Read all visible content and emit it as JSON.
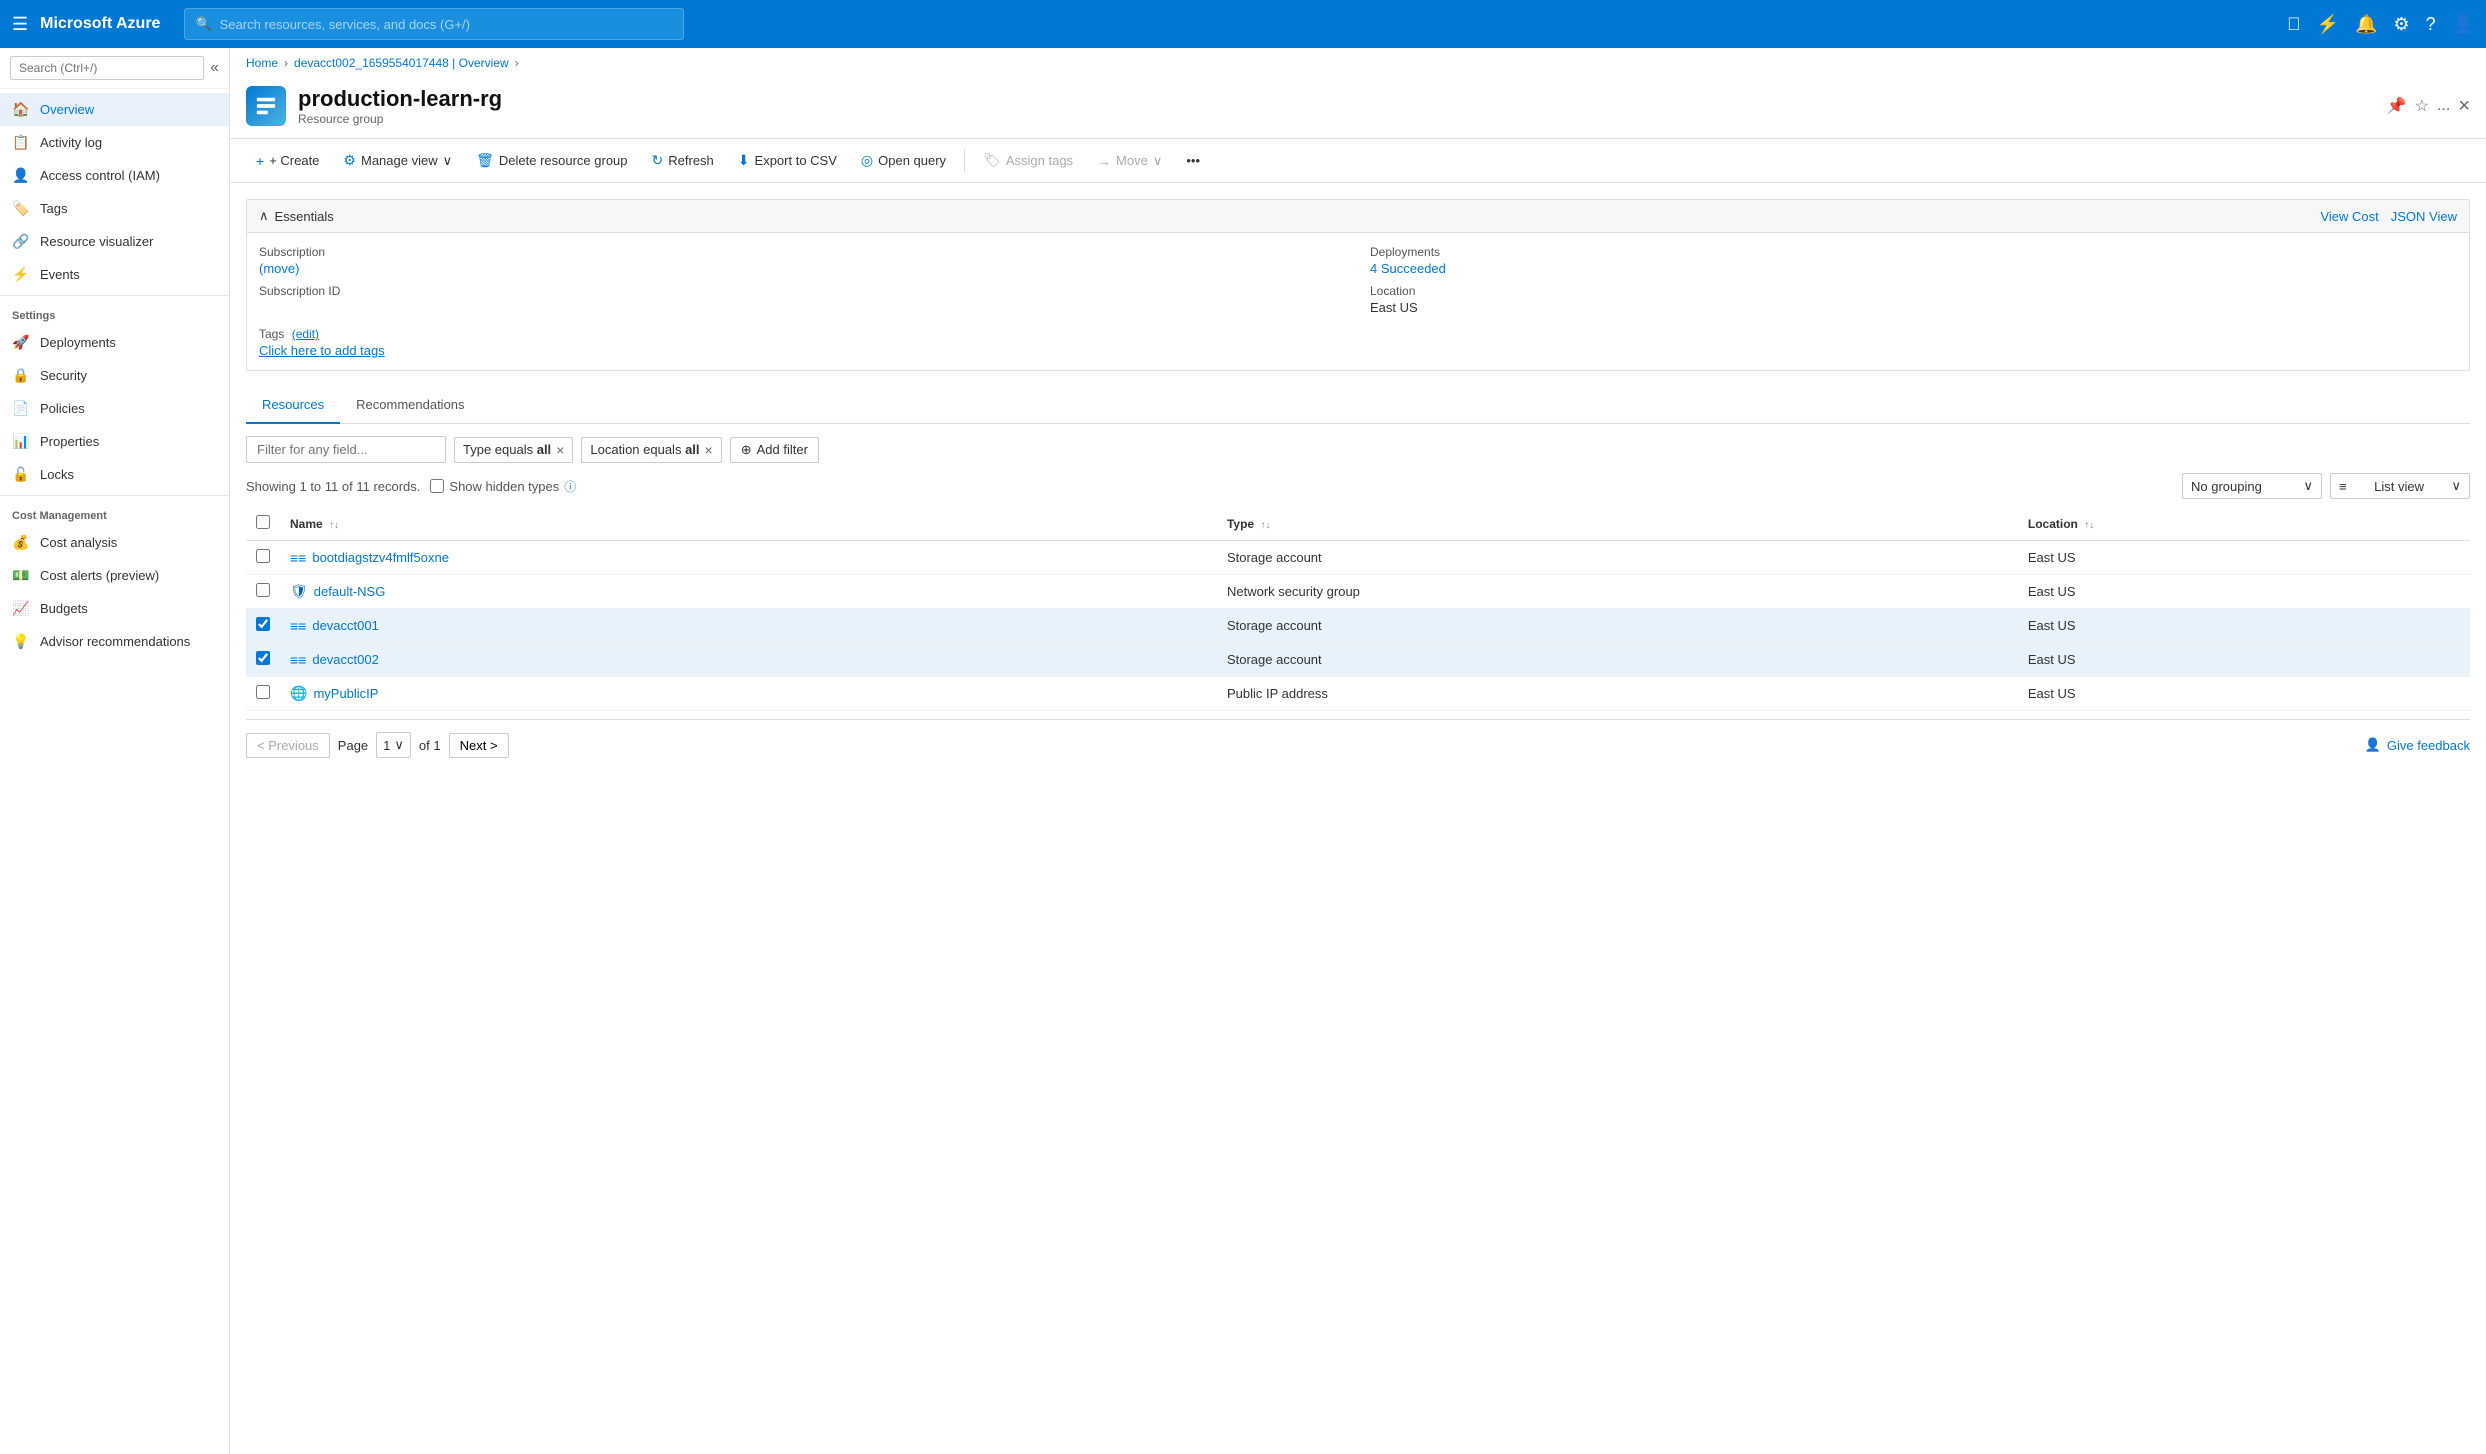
{
  "topbar": {
    "hamburger": "☰",
    "logo": "Microsoft Azure",
    "search_placeholder": "Search resources, services, and docs (G+/)",
    "icons": [
      "envelope",
      "portal",
      "bell",
      "settings",
      "help",
      "user"
    ]
  },
  "breadcrumb": {
    "items": [
      "Home",
      "devacct002_1659554017448 | Overview"
    ]
  },
  "page": {
    "title": "production-learn-rg",
    "subtitle": "Resource group",
    "close_label": "×"
  },
  "header_actions": {
    "pin": "📌",
    "star": "☆",
    "more": "..."
  },
  "toolbar": {
    "create": "+ Create",
    "manage_view": "Manage view",
    "delete": "Delete resource group",
    "refresh": "Refresh",
    "export": "Export to CSV",
    "open_query": "Open query",
    "assign_tags": "Assign tags",
    "move": "Move"
  },
  "essentials": {
    "section_title": "Essentials",
    "view_cost": "View Cost",
    "json_view": "JSON View",
    "fields": [
      {
        "label": "Subscription",
        "value": "",
        "link": "move",
        "link_text": "(move)"
      },
      {
        "label": "Subscription ID",
        "value": ""
      },
      {
        "label": "Deployments",
        "value": "4 Succeeded",
        "is_link": true
      },
      {
        "label": "Location",
        "value": "East US"
      }
    ],
    "tags_label": "Tags",
    "tags_edit": "(edit)",
    "tags_add_link": "Click here to add tags"
  },
  "tabs": {
    "items": [
      "Resources",
      "Recommendations"
    ],
    "active": 0
  },
  "filters": {
    "placeholder": "Filter for any field...",
    "chips": [
      {
        "label": "Type equals all"
      },
      {
        "label": "Location equals all"
      }
    ],
    "add_filter": "Add filter"
  },
  "table_controls": {
    "count_text": "Showing 1 to 11 of 11 records.",
    "show_hidden": "Show hidden types",
    "grouping": "No grouping",
    "view": "List view"
  },
  "table": {
    "columns": [
      "Name",
      "Type",
      "Location"
    ],
    "rows": [
      {
        "name": "bootdiagstzv4fmlf5oxne",
        "type": "Storage account",
        "location": "East US",
        "icon": "storage",
        "selected": false
      },
      {
        "name": "default-NSG",
        "type": "Network security group",
        "location": "East US",
        "icon": "nsg",
        "selected": false
      },
      {
        "name": "devacct001",
        "type": "Storage account",
        "location": "East US",
        "icon": "storage",
        "selected": true
      },
      {
        "name": "devacct002",
        "type": "Storage account",
        "location": "East US",
        "icon": "storage",
        "selected": true
      },
      {
        "name": "myPublicIP",
        "type": "Public IP address",
        "location": "East US",
        "icon": "ip",
        "selected": false
      }
    ]
  },
  "pagination": {
    "prev": "< Previous",
    "page_label": "Page",
    "page_num": "1",
    "of_label": "of 1",
    "next": "Next >",
    "feedback": "Give feedback"
  },
  "sidebar": {
    "search_placeholder": "Search (Ctrl+/)",
    "items": [
      {
        "label": "Overview",
        "icon": "🏠",
        "active": true,
        "section": ""
      },
      {
        "label": "Activity log",
        "icon": "📋",
        "active": false,
        "section": ""
      },
      {
        "label": "Access control (IAM)",
        "icon": "👤",
        "active": false,
        "section": ""
      },
      {
        "label": "Tags",
        "icon": "🏷️",
        "active": false,
        "section": ""
      },
      {
        "label": "Resource visualizer",
        "icon": "🔗",
        "active": false,
        "section": ""
      },
      {
        "label": "Events",
        "icon": "⚡",
        "active": false,
        "section": ""
      }
    ],
    "settings_label": "Settings",
    "settings_items": [
      {
        "label": "Deployments",
        "icon": "🚀"
      },
      {
        "label": "Security",
        "icon": "🔒"
      },
      {
        "label": "Policies",
        "icon": "📄"
      },
      {
        "label": "Properties",
        "icon": "📊"
      },
      {
        "label": "Locks",
        "icon": "🔓"
      }
    ],
    "cost_label": "Cost Management",
    "cost_items": [
      {
        "label": "Cost analysis",
        "icon": "💰"
      },
      {
        "label": "Cost alerts (preview)",
        "icon": "💵"
      },
      {
        "label": "Budgets",
        "icon": "📈"
      },
      {
        "label": "Advisor recommendations",
        "icon": "💡"
      }
    ]
  }
}
